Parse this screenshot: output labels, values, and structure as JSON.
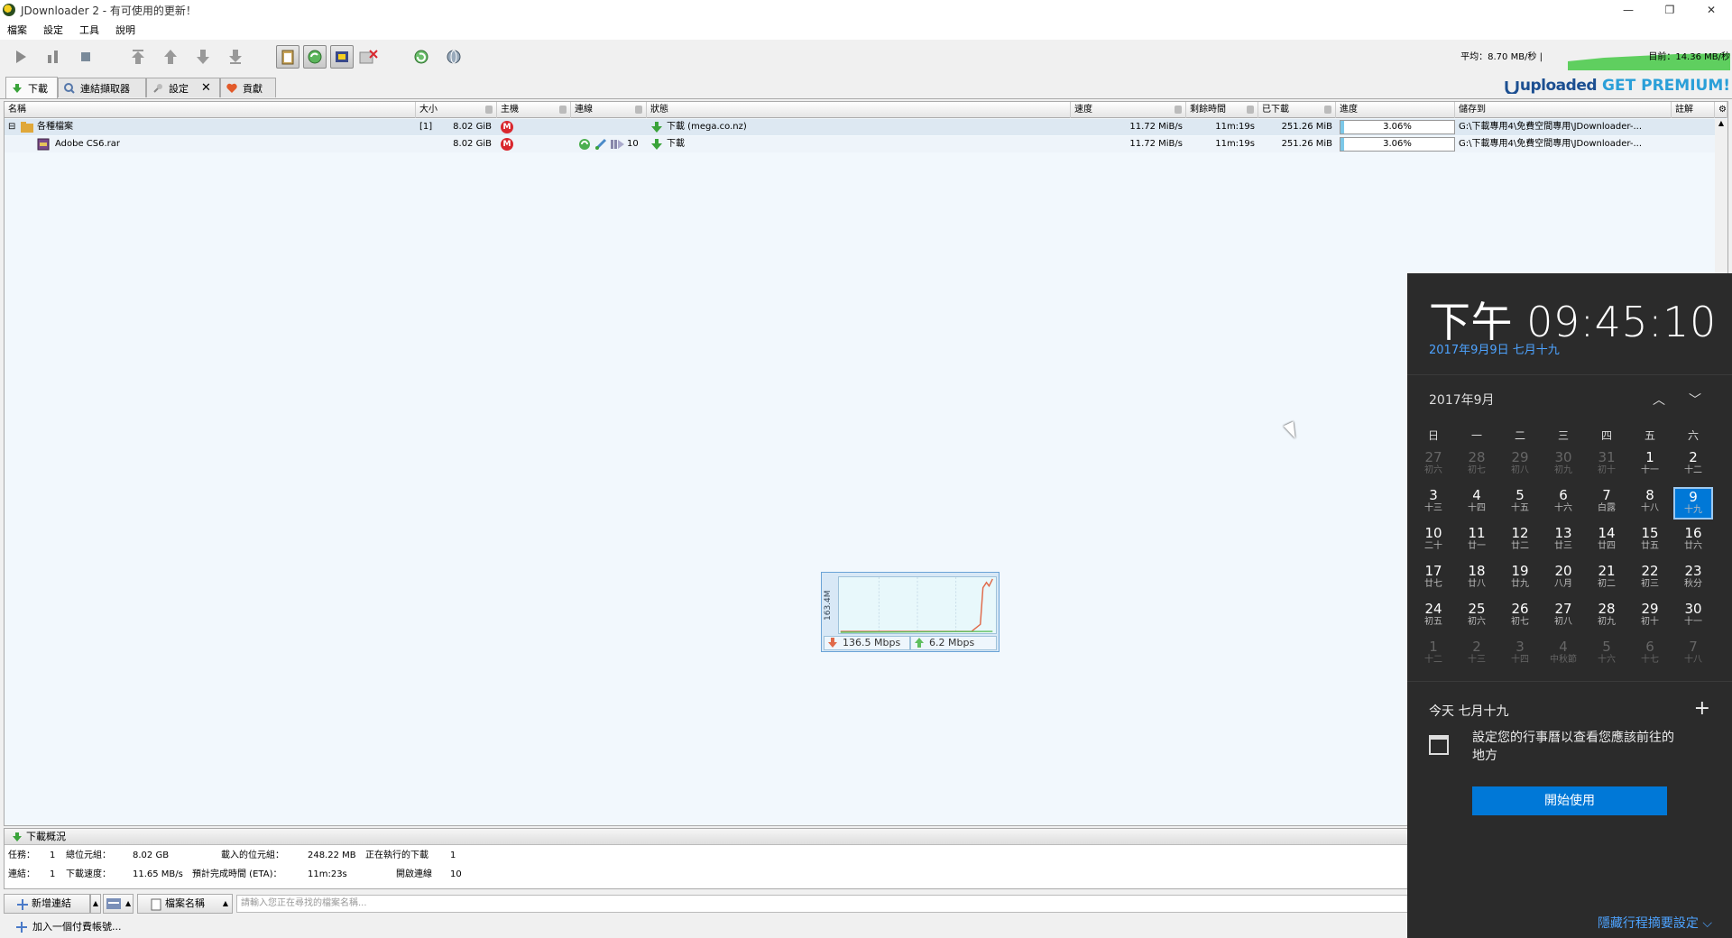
{
  "window": {
    "title": "JDownloader 2 - 有可使用的更新！"
  },
  "menu": [
    "檔案",
    "設定",
    "工具",
    "說明"
  ],
  "toolbar": {
    "speed_avg": "平均：8.70 MB/秒 |",
    "speed_now": "目前：14.36 MB/秒"
  },
  "tabs": [
    {
      "label": "下載"
    },
    {
      "label": "連結擷取器"
    },
    {
      "label": "設定"
    },
    {
      "label": "貢獻"
    }
  ],
  "premium": {
    "brand": "uploaded",
    "cta": "GET PREMIUM!"
  },
  "table": {
    "columns": [
      "名稱",
      "大小",
      "主機",
      "連線",
      "狀態",
      "速度",
      "剩餘時間",
      "已下載",
      "進度",
      "儲存到",
      "註解"
    ],
    "package": {
      "name": "各種檔案",
      "count": "[1]",
      "size": "8.02 GiB",
      "status": "下載 (mega.co.nz)",
      "speed": "11.72 MiB/s",
      "eta": "11m:19s",
      "downloaded": "251.26 MiB",
      "progress": 3.06,
      "progress_label": "3.06%",
      "save_to": "G:\\下載專用4\\免費空間專用\\JDownloader-..."
    },
    "file": {
      "name": "Adobe CS6.rar",
      "size": "8.02 GiB",
      "connections": "10",
      "status": "下載",
      "speed": "11.72 MiB/s",
      "eta": "11m:19s",
      "downloaded": "251.26 MiB",
      "progress": 3.06,
      "progress_label": "3.06%",
      "save_to": "G:\\下載專用4\\免費空間專用\\JDownloader-..."
    }
  },
  "meter": {
    "scale": "163.4M",
    "down": "136.5 Mbps",
    "up": "6.2 Mbps"
  },
  "overview": {
    "title": "下載概況",
    "tasks_label": "任務：",
    "tasks": "1",
    "total_bytes_label": "總位元組：",
    "total_bytes": "8.02 GB",
    "loaded_bytes_label": "載入的位元組：",
    "loaded_bytes": "248.22 MB",
    "running_label": "正在執行的下載",
    "running": "1",
    "links_label": "連結：",
    "links": "1",
    "speed_label": "下載速度：",
    "speed": "11.65 MB/s",
    "eta_label": "預計完成時間 (ETA)：",
    "eta": "11m:23s",
    "conn_label": "開啟連線",
    "conn": "10"
  },
  "bottom": {
    "add_links": "新增連結",
    "filename": "檔案名稱",
    "search_placeholder": "請輸入您正在尋找的檔案名稱...",
    "status": "加入一個付費帳號..."
  },
  "calendar": {
    "time": "下午 09:45:10",
    "date": "2017年9月9日 七月十九",
    "month": "2017年9月",
    "weekdays": [
      "日",
      "一",
      "二",
      "三",
      "四",
      "五",
      "六"
    ],
    "days": [
      [
        "27",
        "初六",
        1
      ],
      [
        "28",
        "初七",
        1
      ],
      [
        "29",
        "初八",
        1
      ],
      [
        "30",
        "初九",
        1
      ],
      [
        "31",
        "初十",
        1
      ],
      [
        "1",
        "十一",
        0
      ],
      [
        "2",
        "十二",
        0
      ],
      [
        "3",
        "十三",
        0
      ],
      [
        "4",
        "十四",
        0
      ],
      [
        "5",
        "十五",
        0
      ],
      [
        "6",
        "十六",
        0
      ],
      [
        "7",
        "白露",
        0
      ],
      [
        "8",
        "十八",
        0
      ],
      [
        "9",
        "十九",
        2
      ],
      [
        "10",
        "二十",
        0
      ],
      [
        "11",
        "廿一",
        0
      ],
      [
        "12",
        "廿二",
        0
      ],
      [
        "13",
        "廿三",
        0
      ],
      [
        "14",
        "廿四",
        0
      ],
      [
        "15",
        "廿五",
        0
      ],
      [
        "16",
        "廿六",
        0
      ],
      [
        "17",
        "廿七",
        0
      ],
      [
        "18",
        "廿八",
        0
      ],
      [
        "19",
        "廿九",
        0
      ],
      [
        "20",
        "八月",
        0
      ],
      [
        "21",
        "初二",
        0
      ],
      [
        "22",
        "初三",
        0
      ],
      [
        "23",
        "秋分",
        0
      ],
      [
        "24",
        "初五",
        0
      ],
      [
        "25",
        "初六",
        0
      ],
      [
        "26",
        "初七",
        0
      ],
      [
        "27",
        "初八",
        0
      ],
      [
        "28",
        "初九",
        0
      ],
      [
        "29",
        "初十",
        0
      ],
      [
        "30",
        "十一",
        0
      ],
      [
        "1",
        "十二",
        1
      ],
      [
        "2",
        "十三",
        1
      ],
      [
        "3",
        "十四",
        1
      ],
      [
        "4",
        "中秋節",
        1
      ],
      [
        "5",
        "十六",
        1
      ],
      [
        "6",
        "十七",
        1
      ],
      [
        "7",
        "十八",
        1
      ]
    ],
    "today_line": "今天 七月十九",
    "message": "設定您的行事曆以查看您應該前往的地方",
    "start_button": "開始使用",
    "hide_link": "隱藏行程摘要設定 ⌵"
  },
  "colors": {
    "accent": "#0078d7",
    "flyout_bg": "#2b2b2b",
    "mega": "#d9272e",
    "progress": "#7cc8e8"
  }
}
